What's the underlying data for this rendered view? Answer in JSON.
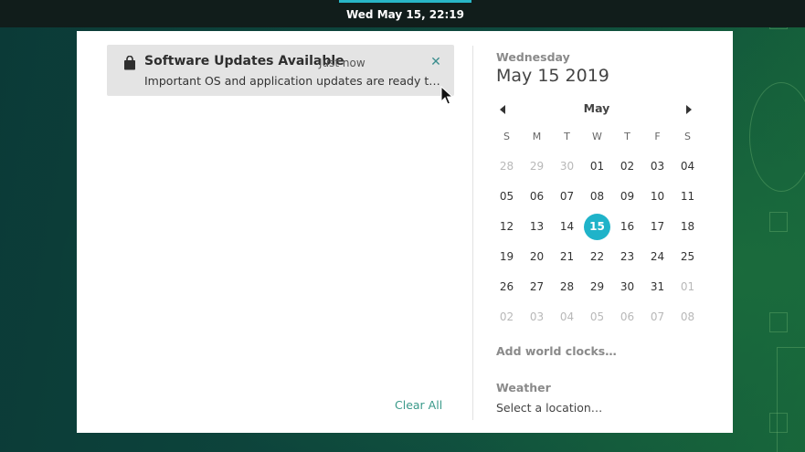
{
  "top_bar": {
    "clock": "Wed May 15, 22:19"
  },
  "notification": {
    "icon": "shopping-bag-icon",
    "title": "Software Updates Available",
    "time": "Just now",
    "body": "Important OS and application updates are ready to be installed",
    "close_icon": "close-icon"
  },
  "notifications_footer": {
    "clear_all": "Clear All"
  },
  "date_header": {
    "weekday": "Wednesday",
    "full_date": "May 15 2019"
  },
  "calendar": {
    "month": "May",
    "prev_icon": "triangle-left-icon",
    "next_icon": "triangle-right-icon",
    "weekday_labels": [
      "S",
      "M",
      "T",
      "W",
      "T",
      "F",
      "S"
    ],
    "weeks": [
      [
        {
          "d": "28",
          "dim": true
        },
        {
          "d": "29",
          "dim": true
        },
        {
          "d": "30",
          "dim": true
        },
        {
          "d": "01"
        },
        {
          "d": "02"
        },
        {
          "d": "03"
        },
        {
          "d": "04"
        }
      ],
      [
        {
          "d": "05"
        },
        {
          "d": "06"
        },
        {
          "d": "07"
        },
        {
          "d": "08"
        },
        {
          "d": "09"
        },
        {
          "d": "10"
        },
        {
          "d": "11"
        }
      ],
      [
        {
          "d": "12"
        },
        {
          "d": "13"
        },
        {
          "d": "14"
        },
        {
          "d": "15",
          "today": true
        },
        {
          "d": "16"
        },
        {
          "d": "17"
        },
        {
          "d": "18"
        }
      ],
      [
        {
          "d": "19"
        },
        {
          "d": "20"
        },
        {
          "d": "21"
        },
        {
          "d": "22"
        },
        {
          "d": "23"
        },
        {
          "d": "24"
        },
        {
          "d": "25"
        }
      ],
      [
        {
          "d": "26"
        },
        {
          "d": "27"
        },
        {
          "d": "28"
        },
        {
          "d": "29"
        },
        {
          "d": "30"
        },
        {
          "d": "31"
        },
        {
          "d": "01",
          "dim": true
        }
      ],
      [
        {
          "d": "02",
          "dim": true
        },
        {
          "d": "03",
          "dim": true
        },
        {
          "d": "04",
          "dim": true
        },
        {
          "d": "05",
          "dim": true
        },
        {
          "d": "06",
          "dim": true
        },
        {
          "d": "07",
          "dim": true
        },
        {
          "d": "08",
          "dim": true
        }
      ]
    ],
    "today_color": "#1fb3c9"
  },
  "world_clocks": {
    "label": "Add world clocks…"
  },
  "weather": {
    "title": "Weather",
    "location": "Select a location…"
  },
  "colors": {
    "accent": "#28b6c6",
    "link": "#3a9a8a"
  }
}
